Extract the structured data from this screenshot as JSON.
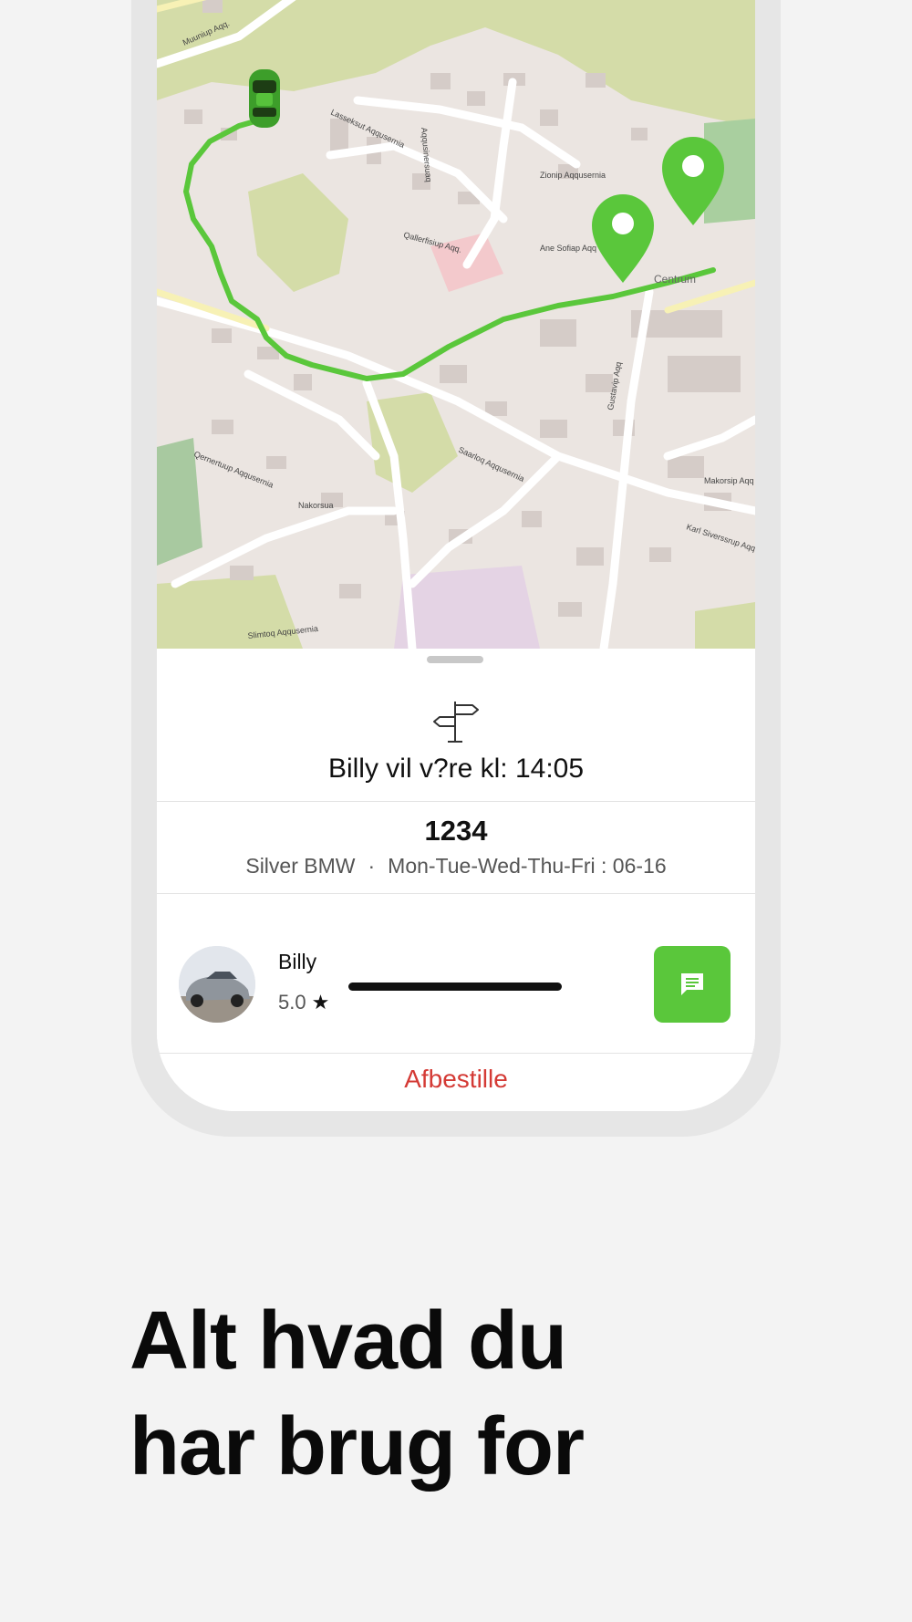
{
  "map": {
    "street_labels": [
      "Muuniup Aqq.",
      "Lasseksut Aqqusernia",
      "Qallerfisiup Aqq.",
      "Aqqusinersuaq",
      "Ane Sofiap Aqq",
      "Zionip Aqqusernia",
      "Centrum",
      "Saarloq Aqqusernia",
      "Makorsip Aqq",
      "Nakorsua",
      "Karl Siverssrup Aqq",
      "Qernertuup Aqqusernia",
      "Gustavip Aqq",
      "Slimtoq Aqqusernia"
    ],
    "route_color": "#5ac73b",
    "pin_color": "#5ac73b",
    "vehicle_icon": "car-icon",
    "pin_icon": "map-pin-icon"
  },
  "trip": {
    "signpost_icon": "signpost-icon",
    "eta_text": "Billy vil v?re kl: 14:05"
  },
  "vehicle": {
    "plate": "1234",
    "description": "Silver BMW",
    "separator": "·",
    "schedule": "Mon-Tue-Wed-Thu-Fri : 06-16"
  },
  "driver": {
    "name": "Billy",
    "rating": "5.0",
    "star": "★",
    "chat_icon": "chat-icon"
  },
  "actions": {
    "cancel_label": "Afbestille"
  },
  "marketing": {
    "headline_line1": "Alt hvad du",
    "headline_line2": "har brug for"
  },
  "colors": {
    "accent": "#5ac73b",
    "danger": "#d43a35",
    "background": "#f3f3f3"
  }
}
